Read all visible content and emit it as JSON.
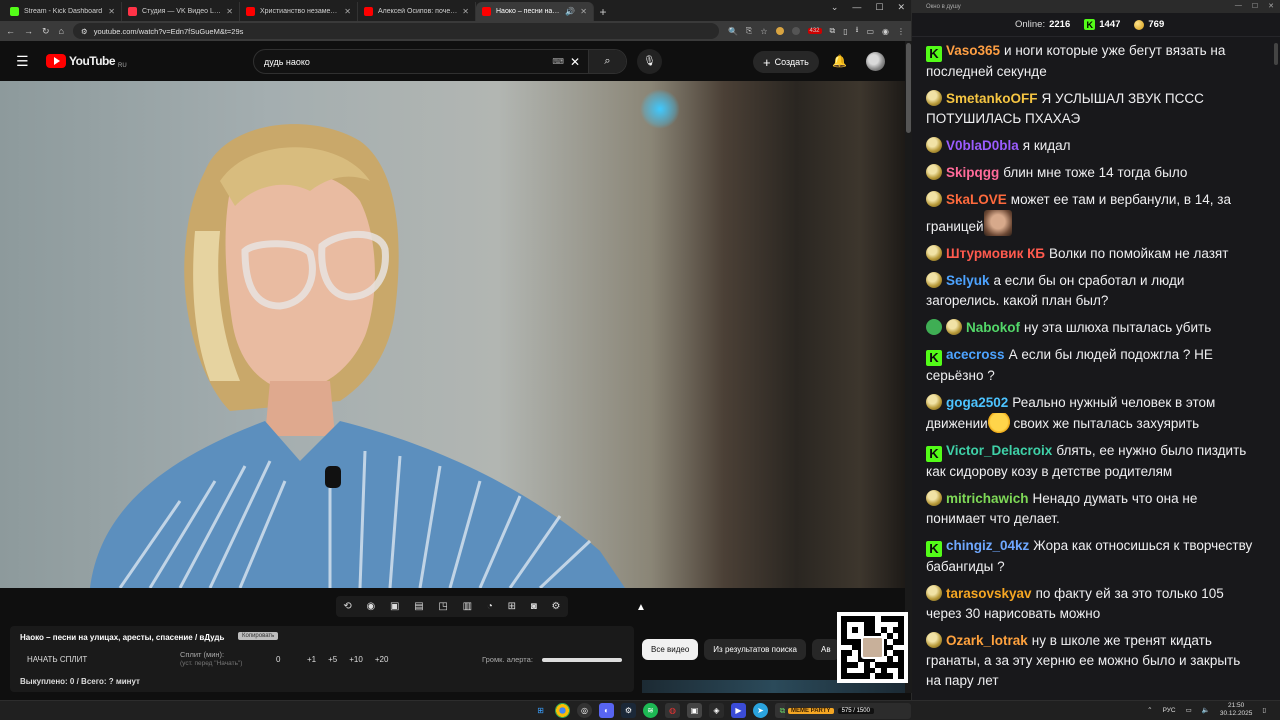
{
  "browser": {
    "tabs": [
      {
        "title": "Stream - Kick Dashboard",
        "favicon_color": "#53fc18"
      },
      {
        "title": "Студия — VK Видео Live",
        "favicon_color": "#ff3347"
      },
      {
        "title": "Христианство незаметно уходит",
        "favicon_color": "#ff0000"
      },
      {
        "title": "Алексей Осипов: почему Бог...",
        "favicon_color": "#ff0000"
      },
      {
        "title": "Наоко – песни на улицах, а...",
        "favicon_color": "#ff0000",
        "active": true
      }
    ],
    "new_tab": "+",
    "url": "youtube.com/watch?v=Edn7fSuGueM&t=29s",
    "extension_badge": "432"
  },
  "youtube": {
    "logo_text": "YouTube",
    "country": "RU",
    "search_query": "дудь наоко",
    "create_label": "Создать",
    "filter_chips": [
      "Все видео",
      "Из результатов поиска",
      "Ав"
    ],
    "accent_color": "#ff0000"
  },
  "split_panel": {
    "title": "Наоко – песни на улицах, аресты, спасение / вДудь",
    "badge": "Копировать",
    "start_button": "НАЧАТЬ СПЛИТ",
    "split_label": "Сплит (мин):",
    "split_hint": "(уст. перед \"Начать\")",
    "split_value": "0",
    "increments": [
      "+1",
      "+5",
      "+10",
      "+20"
    ],
    "alert_volume_label": "Громк. алерта:",
    "bought_text": "Выкуплено: 0 / Всего: ? минут"
  },
  "chat": {
    "window_title": "Окно в душу",
    "online_label": "Online:",
    "online_count": "2216",
    "kick_count": "1447",
    "coin_count": "769",
    "kick_color": "#53fc18",
    "messages": [
      {
        "badge": "kick",
        "user": "Vaso365",
        "color": "#ff9f43",
        "text": "и ноги которые уже бегут вязать на последней секунде"
      },
      {
        "badge": "pepe",
        "user": "SmetankoOFF",
        "color": "#f5c542",
        "text": "Я УСЛЫШАЛ ЗВУК ПСCС ПОТУШИЛАСЬ ПХАХАЭ"
      },
      {
        "badge": "pepe",
        "user": "V0blaD0bla",
        "color": "#9b5cff",
        "text": "я кидал"
      },
      {
        "badge": "pepe",
        "user": "Skipqgg",
        "color": "#ff6b9a",
        "text": "блин мне тоже 14 тогда было"
      },
      {
        "badge": "pepe",
        "user": "SkaLOVE",
        "color": "#ff6a3d",
        "text": "может ее там и вербанули, в 14, за границей",
        "emote": "face"
      },
      {
        "badge": "pepe",
        "user": "Штурмовик КБ",
        "color": "#ff5a4e",
        "text": "Волки по помойкам не лазят"
      },
      {
        "badge": "pepe",
        "user": "Selyuk",
        "color": "#4da3ff",
        "text": "а если бы он сработал и люди загорелись. какой план был?"
      },
      {
        "badge": "shield+pepe",
        "user": "Nabokof",
        "color": "#53d769",
        "text": "ну эта шлюха пыталась убить"
      },
      {
        "badge": "kick",
        "user": "acecross",
        "color": "#4da3ff",
        "text": "А если бы людей подожгла ? НЕ серьёзно ?"
      },
      {
        "badge": "pepe",
        "user": "goga2502",
        "color": "#4dc3ff",
        "text_before": "Реально нужный человек в этом движении",
        "emote": "laugh",
        "text": "своих же пыталась захуярить"
      },
      {
        "badge": "kick",
        "user": "Victor_Delacroix",
        "color": "#3fd1a8",
        "text": "блять, ее нужно было пиздить как сидорову козу в детстве родителям"
      },
      {
        "badge": "pepe",
        "user": "mitrichawich",
        "color": "#7ed957",
        "text": "Ненадо думать что она не понимает что делает."
      },
      {
        "badge": "kick",
        "user": "chingiz_04kz",
        "color": "#6fa8ff",
        "text": "Жора как относишься к творчеству бабангиды ?"
      },
      {
        "badge": "pepe",
        "user": "tarasovskyav",
        "color": "#f5a623",
        "text": "по факту ей за это только 105 через 30 нарисовать можно"
      },
      {
        "badge": "pepe",
        "user": "Ozark_lotrak",
        "color": "#ffa23e",
        "text": "ну в школе же тренят кидать гранаты, а за эту херню ее можно было и закрыть на пару лет"
      }
    ]
  },
  "taskbar": {
    "widget_label": "MEME PARTY",
    "widget_progress": "575 / 1500",
    "lang": "РУС",
    "time": "21:50",
    "date": "30.12.2025"
  }
}
